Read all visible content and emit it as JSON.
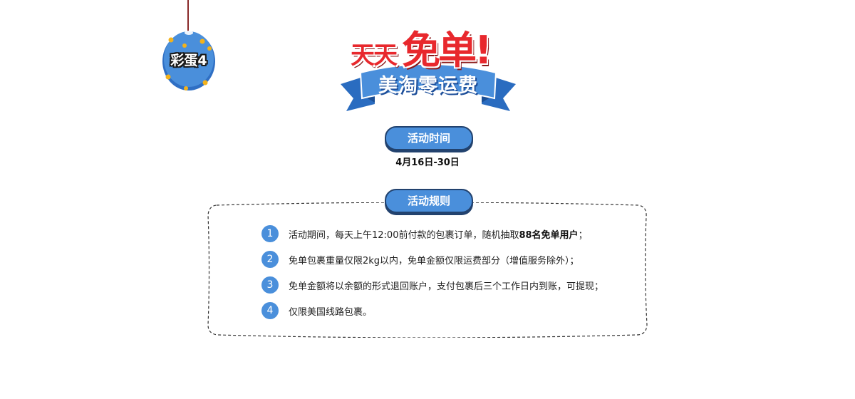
{
  "egg": {
    "label": "彩蛋4"
  },
  "logo": {
    "line1_small": "天天",
    "line1_big": "免单!",
    "ribbon": "美淘零运费"
  },
  "activity_time": {
    "label": "活动时间",
    "date": "4月16日-30日"
  },
  "activity_rules": {
    "label": "活动规则",
    "items": [
      {
        "num": "1",
        "text_before": "活动期间，每天上午12:00前付款的包裹订单，随机抽取",
        "text_bold": "88名免单用户",
        "text_after": "；"
      },
      {
        "num": "2",
        "text_before": "免单包裹重量仅限2kg以内，免单金额仅限运费部分（增值服务除外）；",
        "text_bold": "",
        "text_after": ""
      },
      {
        "num": "3",
        "text_before": "免单金额将以余额的形式退回账户，支付包裹后三个工作日内到账，可提现；",
        "text_bold": "",
        "text_after": ""
      },
      {
        "num": "4",
        "text_before": "仅限美国线路包裹。",
        "text_bold": "",
        "text_after": ""
      }
    ]
  },
  "colors": {
    "accent_blue": "#4a8fdb",
    "title_red": "#e8282d",
    "egg_dots": "#f3b21b"
  }
}
